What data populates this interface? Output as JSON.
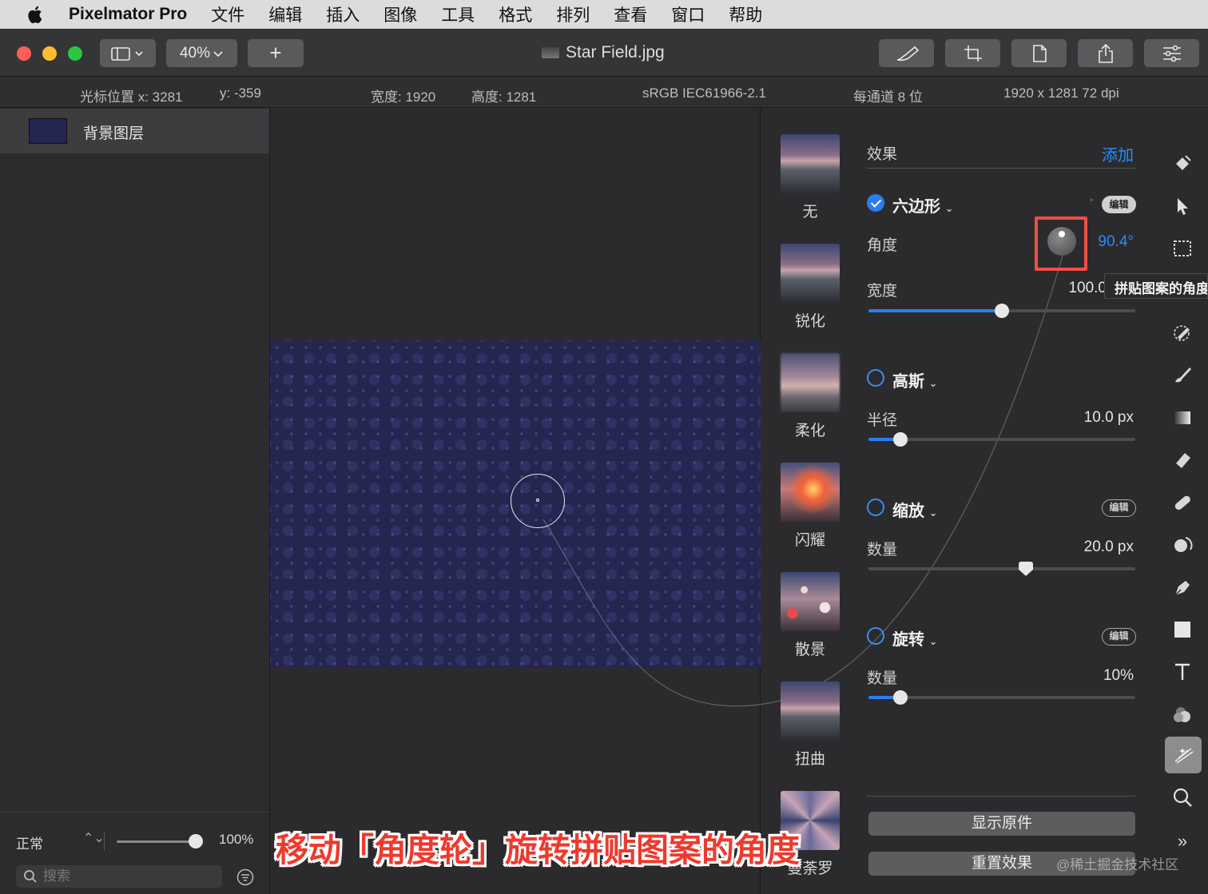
{
  "menubar": {
    "app_name": "Pixelmator Pro",
    "items": [
      "文件",
      "编辑",
      "插入",
      "图像",
      "工具",
      "格式",
      "排列",
      "查看",
      "窗口",
      "帮助"
    ]
  },
  "toolbar": {
    "zoom": "40%",
    "add_label": "+",
    "document_title": "Star Field.jpg"
  },
  "infobar": {
    "cursor_x": "光标位置 x: 3281",
    "cursor_y": "y: -359",
    "width": "宽度: 1920",
    "height": "高度: 1281",
    "color_profile": "sRGB IEC61966-2.1",
    "bit_depth": "每通道 8 位",
    "dimensions": "1920 x 1281 72 dpi"
  },
  "layers": {
    "layer_name": "背景图层",
    "blend_mode": "正常",
    "opacity": "100%",
    "opacity_fraction": 1.0,
    "search_placeholder": "搜索"
  },
  "presets": [
    {
      "label": "无",
      "icon": "mountain-thumbnail"
    },
    {
      "label": "锐化",
      "icon": "mountain-thumbnail"
    },
    {
      "label": "柔化",
      "icon": "blurred-thumbnail"
    },
    {
      "label": "闪耀",
      "icon": "glow-thumbnail"
    },
    {
      "label": "散景",
      "icon": "bokeh-thumbnail"
    },
    {
      "label": "扭曲",
      "icon": "mountain-thumbnail"
    },
    {
      "label": "曼荼罗",
      "icon": "kaleidoscope-thumbnail"
    }
  ],
  "effects": {
    "header": "效果",
    "add_label": "添加",
    "edit_label": "编辑",
    "hexagon": {
      "name": "六边形",
      "enabled": true,
      "angle_label": "角度",
      "angle_value": "90.4°",
      "width_label": "宽度",
      "width_value": "100.0",
      "width_fraction": 0.5
    },
    "gaussian": {
      "name": "高斯",
      "enabled": false,
      "radius_label": "半径",
      "radius_value": "10.0 px",
      "radius_fraction": 0.12
    },
    "zoom": {
      "name": "缩放",
      "enabled": false,
      "amount_label": "数量",
      "amount_value": "20.0 px",
      "amount_fraction": 0.59
    },
    "spin": {
      "name": "旋转",
      "enabled": false,
      "amount_label": "数量",
      "amount_value": "10%",
      "amount_fraction": 0.12
    },
    "show_original": "显示原件",
    "reset": "重置效果"
  },
  "tooltip": "拼贴图案的角度",
  "caption": "移动「角度轮」旋转拼贴图案的角度",
  "watermark": "@稀土掘金技术社区",
  "colors": {
    "accent": "#2a7ef0",
    "highlight": "#f04f45",
    "image_bg": "#242650"
  }
}
